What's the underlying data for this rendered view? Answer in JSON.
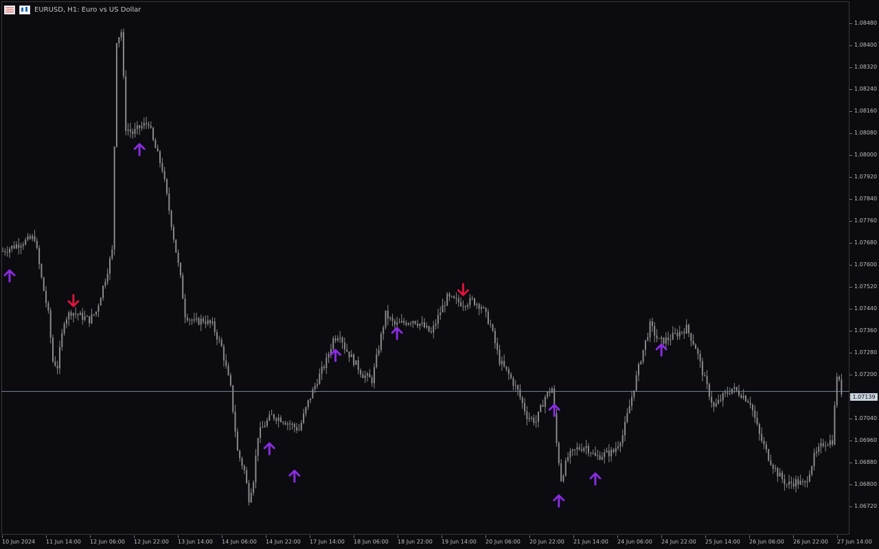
{
  "window": {
    "symbol_title": "EURUSD, H1:  Euro vs US Dollar",
    "icons": [
      "grid-icon",
      "bars-icon"
    ]
  },
  "colors": {
    "background": "#0b0b10",
    "candle": "#8c8c8c",
    "up_arrow": "#8a2be2",
    "down_arrow": "#dc143c",
    "price_line": "#7a8a99"
  },
  "price_axis": {
    "labels": [
      "1.08480",
      "1.08400",
      "1.08320",
      "1.08240",
      "1.08160",
      "1.08080",
      "1.08000",
      "1.07920",
      "1.07840",
      "1.07760",
      "1.07680",
      "1.07600",
      "1.07520",
      "1.07440",
      "1.07360",
      "1.07280",
      "1.07200",
      "1.07120",
      "1.07040",
      "1.06960",
      "1.06880",
      "1.06800",
      "1.06720"
    ],
    "current_price": "1.07139"
  },
  "time_axis": {
    "labels": [
      "10 Jun 2024",
      "11 Jun 14:00",
      "12 Jun 06:00",
      "12 Jun 22:00",
      "13 Jun 14:00",
      "14 Jun 06:00",
      "14 Jun 22:00",
      "17 Jun 14:00",
      "18 Jun 06:00",
      "18 Jun 22:00",
      "19 Jun 14:00",
      "20 Jun 06:00",
      "20 Jun 22:00",
      "21 Jun 14:00",
      "24 Jun 06:00",
      "24 Jun 22:00",
      "25 Jun 14:00",
      "26 Jun 06:00",
      "26 Jun 22:00",
      "27 Jun 14:00"
    ]
  },
  "chart_data": {
    "type": "candlestick",
    "symbol": "EURUSD",
    "timeframe": "H1",
    "ylim": [
      1.0666,
      1.0852
    ],
    "current_price": 1.07139,
    "close_path": [
      [
        0,
        1.0765
      ],
      [
        8,
        1.0768
      ],
      [
        14,
        1.077
      ],
      [
        17,
        1.0755
      ],
      [
        20,
        1.0742
      ],
      [
        22,
        1.0725
      ],
      [
        24,
        1.0723
      ],
      [
        27,
        1.074
      ],
      [
        30,
        1.0743
      ],
      [
        35,
        1.0741
      ],
      [
        38,
        1.074
      ],
      [
        41,
        1.0743
      ],
      [
        45,
        1.0755
      ],
      [
        48,
        1.0765
      ],
      [
        50,
        1.0842
      ],
      [
        52,
        1.0845
      ],
      [
        54,
        1.081
      ],
      [
        57,
        1.0808
      ],
      [
        60,
        1.081
      ],
      [
        64,
        1.0812
      ],
      [
        66,
        1.0805
      ],
      [
        70,
        1.0795
      ],
      [
        72,
        1.0785
      ],
      [
        75,
        1.077
      ],
      [
        78,
        1.0755
      ],
      [
        80,
        1.0742
      ],
      [
        84,
        1.0739
      ],
      [
        88,
        1.074
      ],
      [
        92,
        1.0738
      ],
      [
        96,
        1.073
      ],
      [
        100,
        1.0715
      ],
      [
        103,
        1.0692
      ],
      [
        106,
        1.0685
      ],
      [
        108,
        1.0675
      ],
      [
        110,
        1.0682
      ],
      [
        112,
        1.0698
      ],
      [
        115,
        1.0702
      ],
      [
        118,
        1.0705
      ],
      [
        122,
        1.0704
      ],
      [
        126,
        1.0702
      ],
      [
        130,
        1.07
      ],
      [
        134,
        1.071
      ],
      [
        138,
        1.0718
      ],
      [
        142,
        1.0725
      ],
      [
        145,
        1.0733
      ],
      [
        148,
        1.0735
      ],
      [
        150,
        1.073
      ],
      [
        154,
        1.0725
      ],
      [
        158,
        1.072
      ],
      [
        162,
        1.0718
      ],
      [
        165,
        1.073
      ],
      [
        168,
        1.0742
      ],
      [
        172,
        1.0738
      ],
      [
        176,
        1.0739
      ],
      [
        180,
        1.074
      ],
      [
        184,
        1.0738
      ],
      [
        188,
        1.0735
      ],
      [
        192,
        1.0743
      ],
      [
        195,
        1.0748
      ],
      [
        198,
        1.0747
      ],
      [
        202,
        1.0746
      ],
      [
        206,
        1.0747
      ],
      [
        210,
        1.0745
      ],
      [
        214,
        1.0738
      ],
      [
        218,
        1.0725
      ],
      [
        222,
        1.072
      ],
      [
        226,
        1.0714
      ],
      [
        230,
        1.0705
      ],
      [
        234,
        1.0703
      ],
      [
        238,
        1.0712
      ],
      [
        241,
        1.0715
      ],
      [
        243,
        1.0695
      ],
      [
        245,
        1.0682
      ],
      [
        248,
        1.069
      ],
      [
        252,
        1.0693
      ],
      [
        256,
        1.0694
      ],
      [
        260,
        1.069
      ],
      [
        264,
        1.0691
      ],
      [
        268,
        1.0692
      ],
      [
        272,
        1.0698
      ],
      [
        276,
        1.0712
      ],
      [
        280,
        1.0726
      ],
      [
        284,
        1.0738
      ],
      [
        288,
        1.0732
      ],
      [
        292,
        1.0733
      ],
      [
        296,
        1.0735
      ],
      [
        300,
        1.0737
      ],
      [
        304,
        1.073
      ],
      [
        308,
        1.0718
      ],
      [
        312,
        1.0708
      ],
      [
        316,
        1.0712
      ],
      [
        320,
        1.0715
      ],
      [
        324,
        1.0713
      ],
      [
        328,
        1.071
      ],
      [
        332,
        1.0698
      ],
      [
        336,
        1.069
      ],
      [
        340,
        1.0684
      ],
      [
        344,
        1.068
      ],
      [
        348,
        1.0681
      ],
      [
        352,
        1.068
      ],
      [
        356,
        1.069
      ],
      [
        360,
        1.0695
      ],
      [
        364,
        1.0696
      ],
      [
        366,
        1.072
      ],
      [
        368,
        1.07139
      ]
    ],
    "up_arrows": [
      {
        "bar": 3,
        "price": 1.0756
      },
      {
        "bar": 60,
        "price": 1.0802
      },
      {
        "bar": 117,
        "price": 1.0693
      },
      {
        "bar": 128,
        "price": 1.0683
      },
      {
        "bar": 146,
        "price": 1.0727
      },
      {
        "bar": 173,
        "price": 1.0735
      },
      {
        "bar": 242,
        "price": 1.0707
      },
      {
        "bar": 244,
        "price": 1.0674
      },
      {
        "bar": 260,
        "price": 1.0682
      },
      {
        "bar": 289,
        "price": 1.0729
      }
    ],
    "down_arrows": [
      {
        "bar": 31,
        "price": 1.0747
      },
      {
        "bar": 202,
        "price": 1.0751
      }
    ]
  }
}
